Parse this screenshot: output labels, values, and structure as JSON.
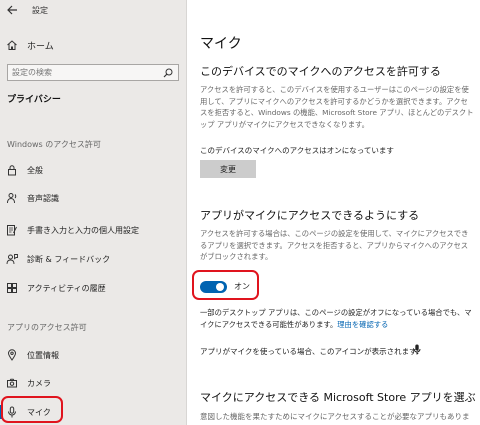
{
  "window": {
    "title": "設定"
  },
  "sidebar": {
    "home_label": "ホーム",
    "search_placeholder": "設定の検索",
    "section_title": "プライバシー",
    "groups": [
      {
        "header": "Windows のアクセス許可",
        "items": [
          {
            "label": "全般",
            "icon": "lock-icon"
          },
          {
            "label": "音声認識",
            "icon": "person-voice-icon"
          },
          {
            "label": "手書き入力と入力の個人用設定",
            "icon": "edit-document-icon"
          },
          {
            "label": "診断 & フィードバック",
            "icon": "feedback-icon"
          },
          {
            "label": "アクティビティの履歴",
            "icon": "timeline-icon"
          }
        ]
      },
      {
        "header": "アプリのアクセス許可",
        "items": [
          {
            "label": "位置情報",
            "icon": "location-icon"
          },
          {
            "label": "カメラ",
            "icon": "camera-icon"
          },
          {
            "label": "マイク",
            "icon": "microphone-icon",
            "selected": true
          }
        ]
      }
    ]
  },
  "main": {
    "title": "マイク",
    "device_access": {
      "heading": "このデバイスでのマイクへのアクセスを許可する",
      "description": "アクセスを許可すると、このデバイスを使用するユーザーはこのページの設定を使用して、アプリにマイクへのアクセスを許可するかどうかを選択できます。アクセスを拒否すると、Windows の機能、Microsoft Store アプリ、ほとんどのデスクトップ アプリがマイクにアクセスできなくなります。",
      "status": "このデバイスのマイクへのアクセスはオンになっています",
      "change_button": "変更"
    },
    "app_access": {
      "heading": "アプリがマイクにアクセスできるようにする",
      "description": "アクセスを許可する場合は、このページの設定を使用して、マイクにアクセスできるアプリを選択できます。アクセスを拒否すると、アプリからマイクへのアクセスがブロックされます。",
      "toggle_label": "オン",
      "toggle_on": true,
      "note": "一部のデスクトップ アプリは、このページの設定がオフになっている場合でも、マイクにアクセスできる可能性があります。",
      "note_link": "理由を確認する",
      "icon_note": "アプリがマイクを使っている場合、このアイコンが表示されます:"
    },
    "store_apps": {
      "heading": "マイクにアクセスできる Microsoft Store アプリを選ぶ",
      "description": "意図した機能を果たすためにマイクにアクセスすることが必要なアプリもありま"
    }
  },
  "colors": {
    "accent": "#0063b1",
    "highlight": "#e0141e",
    "sidebar_bg": "#ebe9e7"
  }
}
